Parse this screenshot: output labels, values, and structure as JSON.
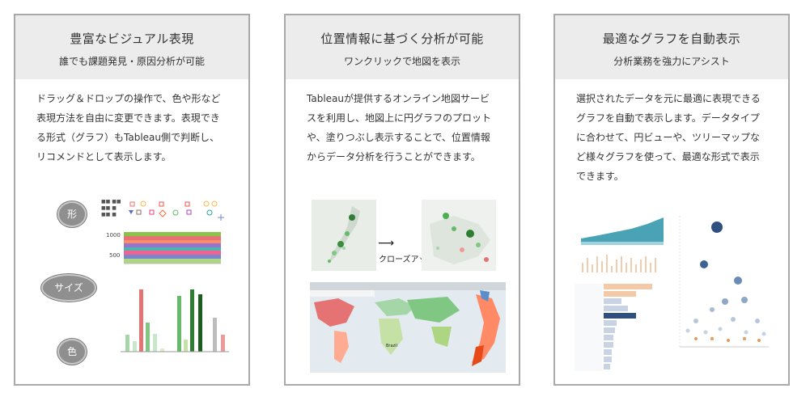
{
  "cards": [
    {
      "title": "豊富なビジュアル表現",
      "subtitle": "誰でも課題発見・原因分析が可能",
      "body": "ドラッグ＆ドロップの操作で、色や形など表現方法を自由に変更できます。表現できる形式（グラフ）もTableau側で判断し、リコメンドとして表示します。",
      "figure": {
        "shape_label": "形",
        "size_label": "サイズ",
        "color_label": "色",
        "axis_ticks": [
          "1000",
          "500"
        ]
      }
    },
    {
      "title": "位置情報に基づく分析が可能",
      "subtitle": "ワンクリックで地図を表示",
      "body": "Tableauが提供するオンライン地図サービスを利用し、地図上に円グラフのプロットや、塗りつぶし表示することで、位置情報からデータ分析を行うことができます。",
      "figure": {
        "closeup_label": "クローズアップ",
        "arrow": "⟶"
      }
    },
    {
      "title": "最適なグラフを自動表示",
      "subtitle": "分析業務を強力にアシスト",
      "body": "選択されたデータを元に最適に表現できるグラフを自動で表示します。データタイプに合わせて、円ビューや、ツリーマップなど様々グラフを使って、最適な形式で表示できます。"
    }
  ],
  "colors": {
    "header_bg": "#ececec",
    "border": "#a9a9a9",
    "green_dark": "#2e7d32",
    "green_light": "#8bc34a",
    "salmon": "#e57373",
    "teal": "#4aa3b5",
    "navy": "#2f4f7f",
    "orange": "#e69a5a"
  }
}
